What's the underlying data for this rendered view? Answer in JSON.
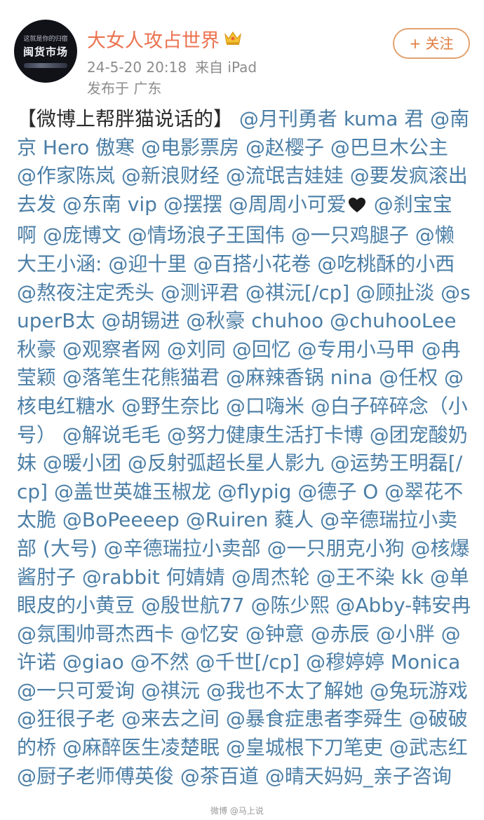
{
  "header": {
    "avatar_sub_text": "这就是你的归宿",
    "avatar_main_text": "闽货市场",
    "user_name": "大女人攻占世界",
    "timestamp": "24-5-20 20:18",
    "source": "来自 iPad",
    "location": "发布于 广东",
    "follow_label": "+ 关注",
    "crown_icon": "crown-badge-icon"
  },
  "post": {
    "intro": "【微博上帮胖猫说话的】",
    "heart_icon": "black-heart-icon",
    "mentions": [
      "@月刊勇者 kuma 君",
      "@南京 Hero 傲寒",
      "@电影票房",
      "@赵樱子",
      "@巴旦木公主",
      "@作家陈岚",
      "@新浪财经",
      "@流氓吉娃娃",
      "@要发疯滚出去发",
      "@东南 vip",
      "@摆摆",
      "@周周小可爱",
      "@刹宝宝啊",
      "@庞博文",
      "@情场浪子王国伟",
      "@一只鸡腿子",
      "@懒大王小涵:",
      "@迎十里",
      "@百搭小花卷",
      "@吃桃酥的小西",
      "@熬夜注定秃头",
      "@测评君",
      "@祺沅[/cp]",
      "@顾扯淡",
      "@superB太",
      "@胡锡进",
      "@秋豪 chuhoo",
      "@chuhooLee秋豪",
      "@观察者网",
      "@刘同",
      "@回忆",
      "@专用小马甲",
      "@冉莹颖",
      "@落笔生花熊猫君",
      "@麻辣香锅 nina",
      "@任权",
      "@核电红糖水",
      "@野生奈比",
      "@口嗨米",
      "@白子碎碎念（小号）",
      "@解说毛毛",
      "@努力健康生活打卡博",
      "@团宠酸奶妹",
      "@暖小团",
      "@反射弧超长星人影九",
      "@运势王明磊[/cp]",
      "@盖世英雄玉椒龙",
      "@flypig",
      "@德子 O",
      "@翠花不太脆",
      "@BoPeeeep",
      "@Ruiren 蕤人",
      "@辛德瑞拉小卖部 (大号)",
      "@辛德瑞拉小卖部",
      "@一只朋克小狗",
      "@核爆酱肘子",
      "@rabbit 何婧婧",
      "@周杰轮",
      "@王不染 kk",
      "@单眼皮的小黄豆",
      "@殷世航77",
      "@陈少熙",
      "@Abby-韩安冉",
      "@氛围帅哥杰西卡",
      "@忆安",
      "@钟意",
      "@赤辰",
      "@小胖",
      "@许诺",
      "@giao",
      "@不然",
      "@千世[/cp]",
      "@穆婷婷 Monica",
      "@一只可爱询",
      "@祺沅",
      "@我也不太了解她",
      "@兔玩游戏",
      "@狂很子老",
      "@来去之间",
      "@暴食症患者李舜生",
      "@破破的桥",
      "@麻醉医生凌楚眠",
      "@皇城根下刀笔吏",
      "@武志红",
      "@厨子老师傅英俊",
      "@茶百道",
      "@晴天妈妈_亲子咨询"
    ]
  },
  "watermark": "微博 @马上说",
  "colors": {
    "user_name": "#eb7350",
    "mention": "#4b7ea6",
    "body_text": "#2a2a2a",
    "meta_text": "#8c8c8c",
    "follow_border": "#e2a36f"
  }
}
